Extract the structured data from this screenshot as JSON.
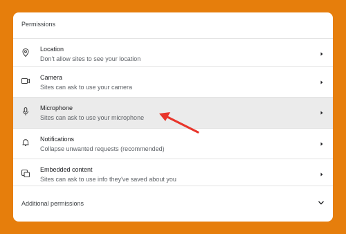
{
  "colors": {
    "background": "#e67e0c",
    "card": "#ffffff",
    "highlight_row": "#ebebeb",
    "annotation_arrow": "#e8352b"
  },
  "section": {
    "title": "Permissions"
  },
  "permissions": [
    {
      "title": "Location",
      "subtitle": "Don't allow sites to see your location",
      "icon": "location-pin-icon"
    },
    {
      "title": "Camera",
      "subtitle": "Sites can ask to use your camera",
      "icon": "camera-icon"
    },
    {
      "title": "Microphone",
      "subtitle": "Sites can ask to use your microphone",
      "icon": "microphone-icon"
    },
    {
      "title": "Notifications",
      "subtitle": "Collapse unwanted requests (recommended)",
      "icon": "bell-icon"
    },
    {
      "title": "Embedded content",
      "subtitle": "Sites can ask to use info they've saved about you",
      "icon": "embedded-content-icon"
    }
  ],
  "additional": {
    "label": "Additional permissions",
    "icon": "chevron-down-icon"
  }
}
